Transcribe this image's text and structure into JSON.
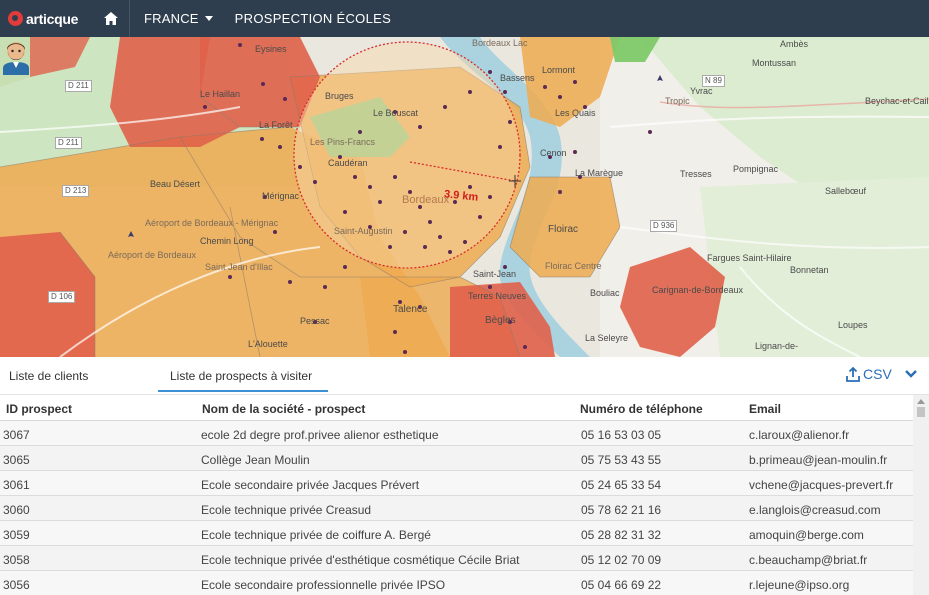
{
  "header": {
    "logo_text": "articque",
    "country": "FRANCE",
    "title": "PROSPECTION ÉCOLES"
  },
  "map": {
    "radius_label": "3.9 km",
    "labels": {
      "eysines": "Eysines",
      "le_haillan": "Le Haillan",
      "la_foret": "La Forêt",
      "le_bouscat": "Le Bouscat",
      "bruges": "Bruges",
      "caudéran": "Caudéran",
      "les_pins_francs": "Les Pins-Francs",
      "merignac": "Mérignac",
      "beau_desert": "Beau Désert",
      "chemin_long": "Chemin Long",
      "aeroport": "Aéroport de Bordeaux - Mérignac",
      "aeroport_zone": "Aéroport de Bordeaux",
      "saint_jean_illac": "Saint Jean d'Illac",
      "bordeaux": "Bordeaux",
      "saint_augustin": "Saint-Augustin",
      "saint_jean": "Saint-Jean",
      "lormont": "Lormont",
      "les_quais": "Les Quais",
      "bassens": "Bassens",
      "cenon": "Cenon",
      "la_maregue": "La Marègue",
      "floirac": "Floirac",
      "floirac_town": "Floirac Centre",
      "yvrac": "Yvrac",
      "montussan": "Montussan",
      "beychac": "Beychac-et-Caillau",
      "tresses": "Tresses",
      "pompignac": "Pompignac",
      "sallebouef": "Sallebœuf",
      "fargues": "Fargues Saint-Hilaire",
      "bonnetan": "Bonnetan",
      "carignan": "Carignan-de-Bordeaux",
      "bouliac": "Bouliac",
      "la_seleyre": "La Seleyre",
      "loupes": "Loupes",
      "lignan": "Lignan-de-",
      "begles": "Bègles",
      "terres_neuves": "Terres Neuves",
      "talence": "Talence",
      "pessac": "Pessac",
      "l_alouette": "L'Alouette",
      "ambares": "Ambès",
      "bordeaux_lac": "Bordeaux Lac",
      "tropic": "Tropic"
    },
    "roads": {
      "d211a": "D 211",
      "d211b": "D 211",
      "d213": "D 213",
      "d106": "D 106",
      "n89": "N 89",
      "d936": "D 936"
    }
  },
  "panel": {
    "tabs": [
      "Liste de clients",
      "Liste de prospects à visiter"
    ],
    "active_tab": 1,
    "csv_label": "CSV",
    "columns": {
      "id": "ID prospect",
      "name": "Nom de la société - prospect",
      "phone": "Numéro de téléphone",
      "email": "Email"
    },
    "rows": [
      {
        "id": "3067",
        "name": "ecole 2d degre prof.privee alienor esthetique",
        "phone": "05 16 53 03 05",
        "email": "c.laroux@alienor.fr"
      },
      {
        "id": "3065",
        "name": "Collège Jean Moulin",
        "phone": "05 75 53 43 55",
        "email": "b.primeau@jean-moulin.fr"
      },
      {
        "id": "3061",
        "name": "Ecole secondaire privée Jacques Prévert",
        "phone": "05 24 65 33 54",
        "email": "vchene@jacques-prevert.fr"
      },
      {
        "id": "3060",
        "name": "Ecole technique privée Creasud",
        "phone": "05 78 62 21 16",
        "email": "e.langlois@creasud.com"
      },
      {
        "id": "3059",
        "name": "Ecole technique privée de coiffure A. Bergé",
        "phone": "05 28 82 31 32",
        "email": "amoquin@berge.com"
      },
      {
        "id": "3058",
        "name": "Ecole technique privée d'esthétique cosmétique Cécile Briat",
        "phone": "05 12 02 70 09",
        "email": "c.beauchamp@briat.fr"
      },
      {
        "id": "3056",
        "name": "Ecole secondaire professionnelle privée IPSO",
        "phone": "05 04 66 69 22",
        "email": "r.lejeune@ipso.org"
      }
    ]
  },
  "colors": {
    "topbar": "#2f3e4e",
    "accent": "#3d8fd6",
    "red_zone": "#e0614a",
    "orange_zone": "#eeaa50",
    "green_zone": "#8fce8a",
    "radius_circle": "#d92b2b"
  }
}
